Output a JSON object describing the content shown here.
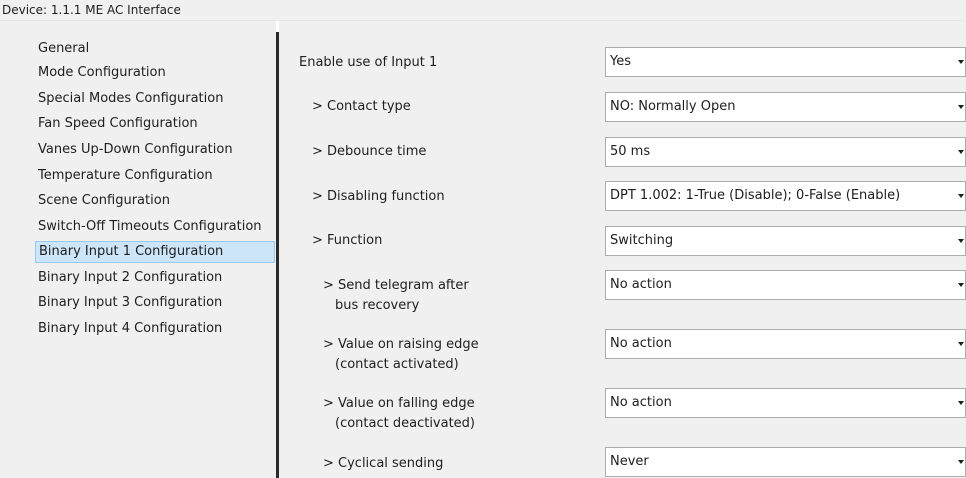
{
  "window": {
    "title": "Device: 1.1.1  ME AC Interface"
  },
  "sidebar": {
    "items": [
      {
        "label": "General"
      },
      {
        "label": "Mode Configuration"
      },
      {
        "label": "Special Modes Configuration"
      },
      {
        "label": "Fan Speed Configuration"
      },
      {
        "label": "Vanes Up-Down Configuration"
      },
      {
        "label": "Temperature Configuration"
      },
      {
        "label": "Scene Configuration"
      },
      {
        "label": "Switch-Off Timeouts Configuration"
      },
      {
        "label": "Binary Input 1 Configuration",
        "selected": true
      },
      {
        "label": "Binary Input 2 Configuration"
      },
      {
        "label": "Binary Input 3 Configuration"
      },
      {
        "label": "Binary Input 4 Configuration"
      }
    ]
  },
  "params": [
    {
      "label": "Enable use of Input 1",
      "value": "Yes"
    },
    {
      "label": "> Contact type",
      "value": "NO: Normally Open"
    },
    {
      "label": "> Debounce time",
      "value": "50 ms"
    },
    {
      "label": "> Disabling function",
      "value": "DPT 1.002: 1-True (Disable); 0-False (Enable)"
    },
    {
      "label": "> Function",
      "value": "Switching"
    },
    {
      "label": "> Send telegram after",
      "label2": "bus recovery",
      "value": "No action"
    },
    {
      "label": "> Value on raising edge",
      "label2": "(contact activated)",
      "value": "No action"
    },
    {
      "label": "> Value on falling edge",
      "label2": "(contact deactivated)",
      "value": "No action"
    },
    {
      "label": "> Cyclical sending",
      "value": "Never"
    }
  ],
  "colors": {
    "panel_bg": "#f0f0f0",
    "selection_bg": "#cde5f8",
    "selection_border": "#99c9ef",
    "splitter": "#2a2a2a"
  }
}
